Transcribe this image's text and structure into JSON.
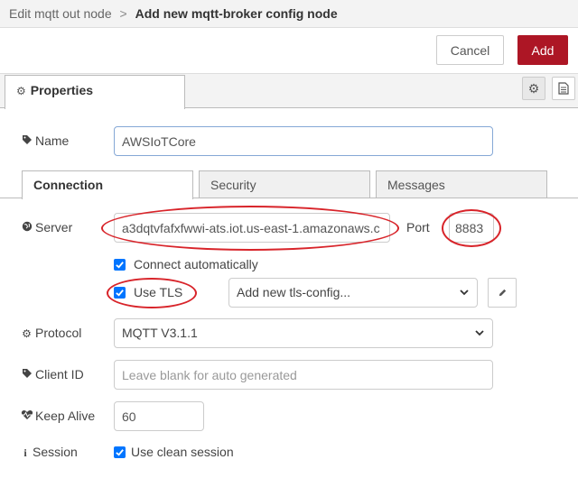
{
  "header": {
    "breadcrumb_prev": "Edit mqtt out node",
    "separator": ">",
    "title": "Add new mqtt-broker config node"
  },
  "toolbar": {
    "cancel_label": "Cancel",
    "add_label": "Add"
  },
  "tabs": {
    "properties_label": "Properties"
  },
  "form": {
    "name_label": "Name",
    "name_value": "AWSIoTCore",
    "subtabs": [
      "Connection",
      "Security",
      "Messages"
    ],
    "server_label": "Server",
    "server_value": "a3dqtvfafxfwwi-ats.iot.us-east-1.amazonaws.c",
    "port_label": "Port",
    "port_value": "8883",
    "connect_auto_label": "Connect automatically",
    "connect_auto_checked": true,
    "use_tls_label": "Use TLS",
    "use_tls_checked": true,
    "tls_config_value": "Add new tls-config...",
    "protocol_label": "Protocol",
    "protocol_value": "MQTT V3.1.1",
    "client_id_label": "Client ID",
    "client_id_placeholder": "Leave blank for auto generated",
    "keep_alive_label": "Keep Alive",
    "keep_alive_value": "60",
    "session_label": "Session",
    "clean_session_label": "Use clean session",
    "clean_session_checked": true
  },
  "colors": {
    "accent": "#ad1625",
    "checkbox": "#0075ff",
    "highlight_ring": "#d8242a"
  },
  "icons": [
    "gear-icon",
    "document-icon",
    "tag-icon",
    "globe-icon",
    "pencil-icon",
    "heartbeat-icon",
    "info-icon",
    "chevron-down-icon"
  ]
}
